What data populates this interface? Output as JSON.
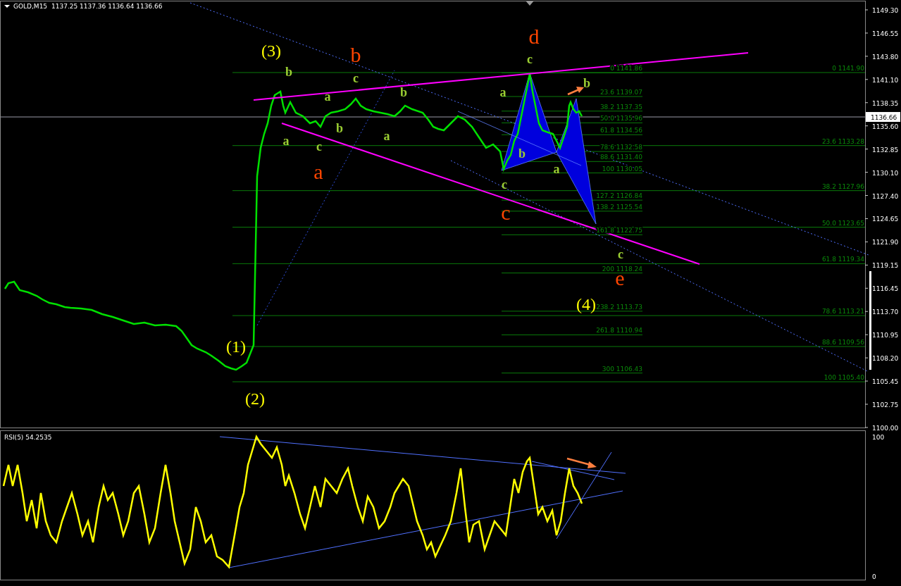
{
  "chart": {
    "symbol": "GOLD,M15",
    "ohlc": "1137.25 1137.36 1136.64 1136.66",
    "current_price": "1136.66",
    "price_axis": [
      "1149.30",
      "1146.55",
      "1143.80",
      "1141.10",
      "1138.35",
      "1135.60",
      "1132.85",
      "1130.10",
      "1127.40",
      "1124.65",
      "1121.90",
      "1119.15",
      "1116.45",
      "1113.70",
      "1110.95",
      "1108.20",
      "1105.45",
      "1102.75",
      "1100.00"
    ],
    "wave_labels": [
      {
        "text": "(3)",
        "kind": "large",
        "color": "#ffff00"
      },
      {
        "text": "b",
        "kind": "huge",
        "color": "#ff4500"
      },
      {
        "text": "d",
        "kind": "huge",
        "color": "#ff4500"
      },
      {
        "text": "a",
        "kind": "huge",
        "color": "#ff4500"
      },
      {
        "text": "c",
        "kind": "huge",
        "color": "#ff4500"
      },
      {
        "text": "e",
        "kind": "huge",
        "color": "#ff4500"
      },
      {
        "text": "(4)",
        "kind": "large",
        "color": "#ffff00"
      },
      {
        "text": "(1)",
        "kind": "large",
        "color": "#ffff00"
      },
      {
        "text": "(2)",
        "kind": "large",
        "color": "#ffff00"
      },
      {
        "text": "b",
        "kind": "small",
        "color": "#9acd32"
      },
      {
        "text": "c",
        "kind": "small",
        "color": "#9acd32"
      },
      {
        "text": "a",
        "kind": "small",
        "color": "#9acd32"
      },
      {
        "text": "b",
        "kind": "small",
        "color": "#9acd32"
      },
      {
        "text": "b",
        "kind": "small",
        "color": "#9acd32"
      },
      {
        "text": "a",
        "kind": "small",
        "color": "#9acd32"
      },
      {
        "text": "c",
        "kind": "small",
        "color": "#9acd32"
      },
      {
        "text": "a",
        "kind": "small",
        "color": "#9acd32"
      },
      {
        "text": "c",
        "kind": "small",
        "color": "#9acd32"
      },
      {
        "text": "a",
        "kind": "small",
        "color": "#9acd32"
      },
      {
        "text": "b",
        "kind": "small",
        "color": "#9acd32"
      },
      {
        "text": "a",
        "kind": "small",
        "color": "#9acd32"
      },
      {
        "text": "c",
        "kind": "small",
        "color": "#9acd32"
      },
      {
        "text": "b",
        "kind": "small",
        "color": "#9acd32"
      },
      {
        "text": "c",
        "kind": "small",
        "color": "#9acd32"
      }
    ],
    "fib_near": [
      "0 1141.86",
      "23.6 1139.07",
      "38.2 1137.35",
      "50.0 1135.96",
      "61.8 1134.56",
      "78.6 1132.58",
      "88.6 1131.40",
      "100 1130.05",
      "127.2 1126.84",
      "138.2 1125.54",
      "161.8 1122.75",
      "200 1118.24",
      "238.2 1113.73",
      "261.8 1110.94",
      "300 1106.43"
    ],
    "fib_wide": [
      "0 1141.90",
      "23.6 1133.28",
      "38.2 1127.96",
      "50.0 1123.65",
      "61.8 1119.34",
      "78.6 1113.21",
      "88.6 1109.56",
      "100 1105.40"
    ]
  },
  "rsi_panel": {
    "title": "RSI(5) 54.2535",
    "axis": [
      "100",
      "0"
    ]
  }
}
